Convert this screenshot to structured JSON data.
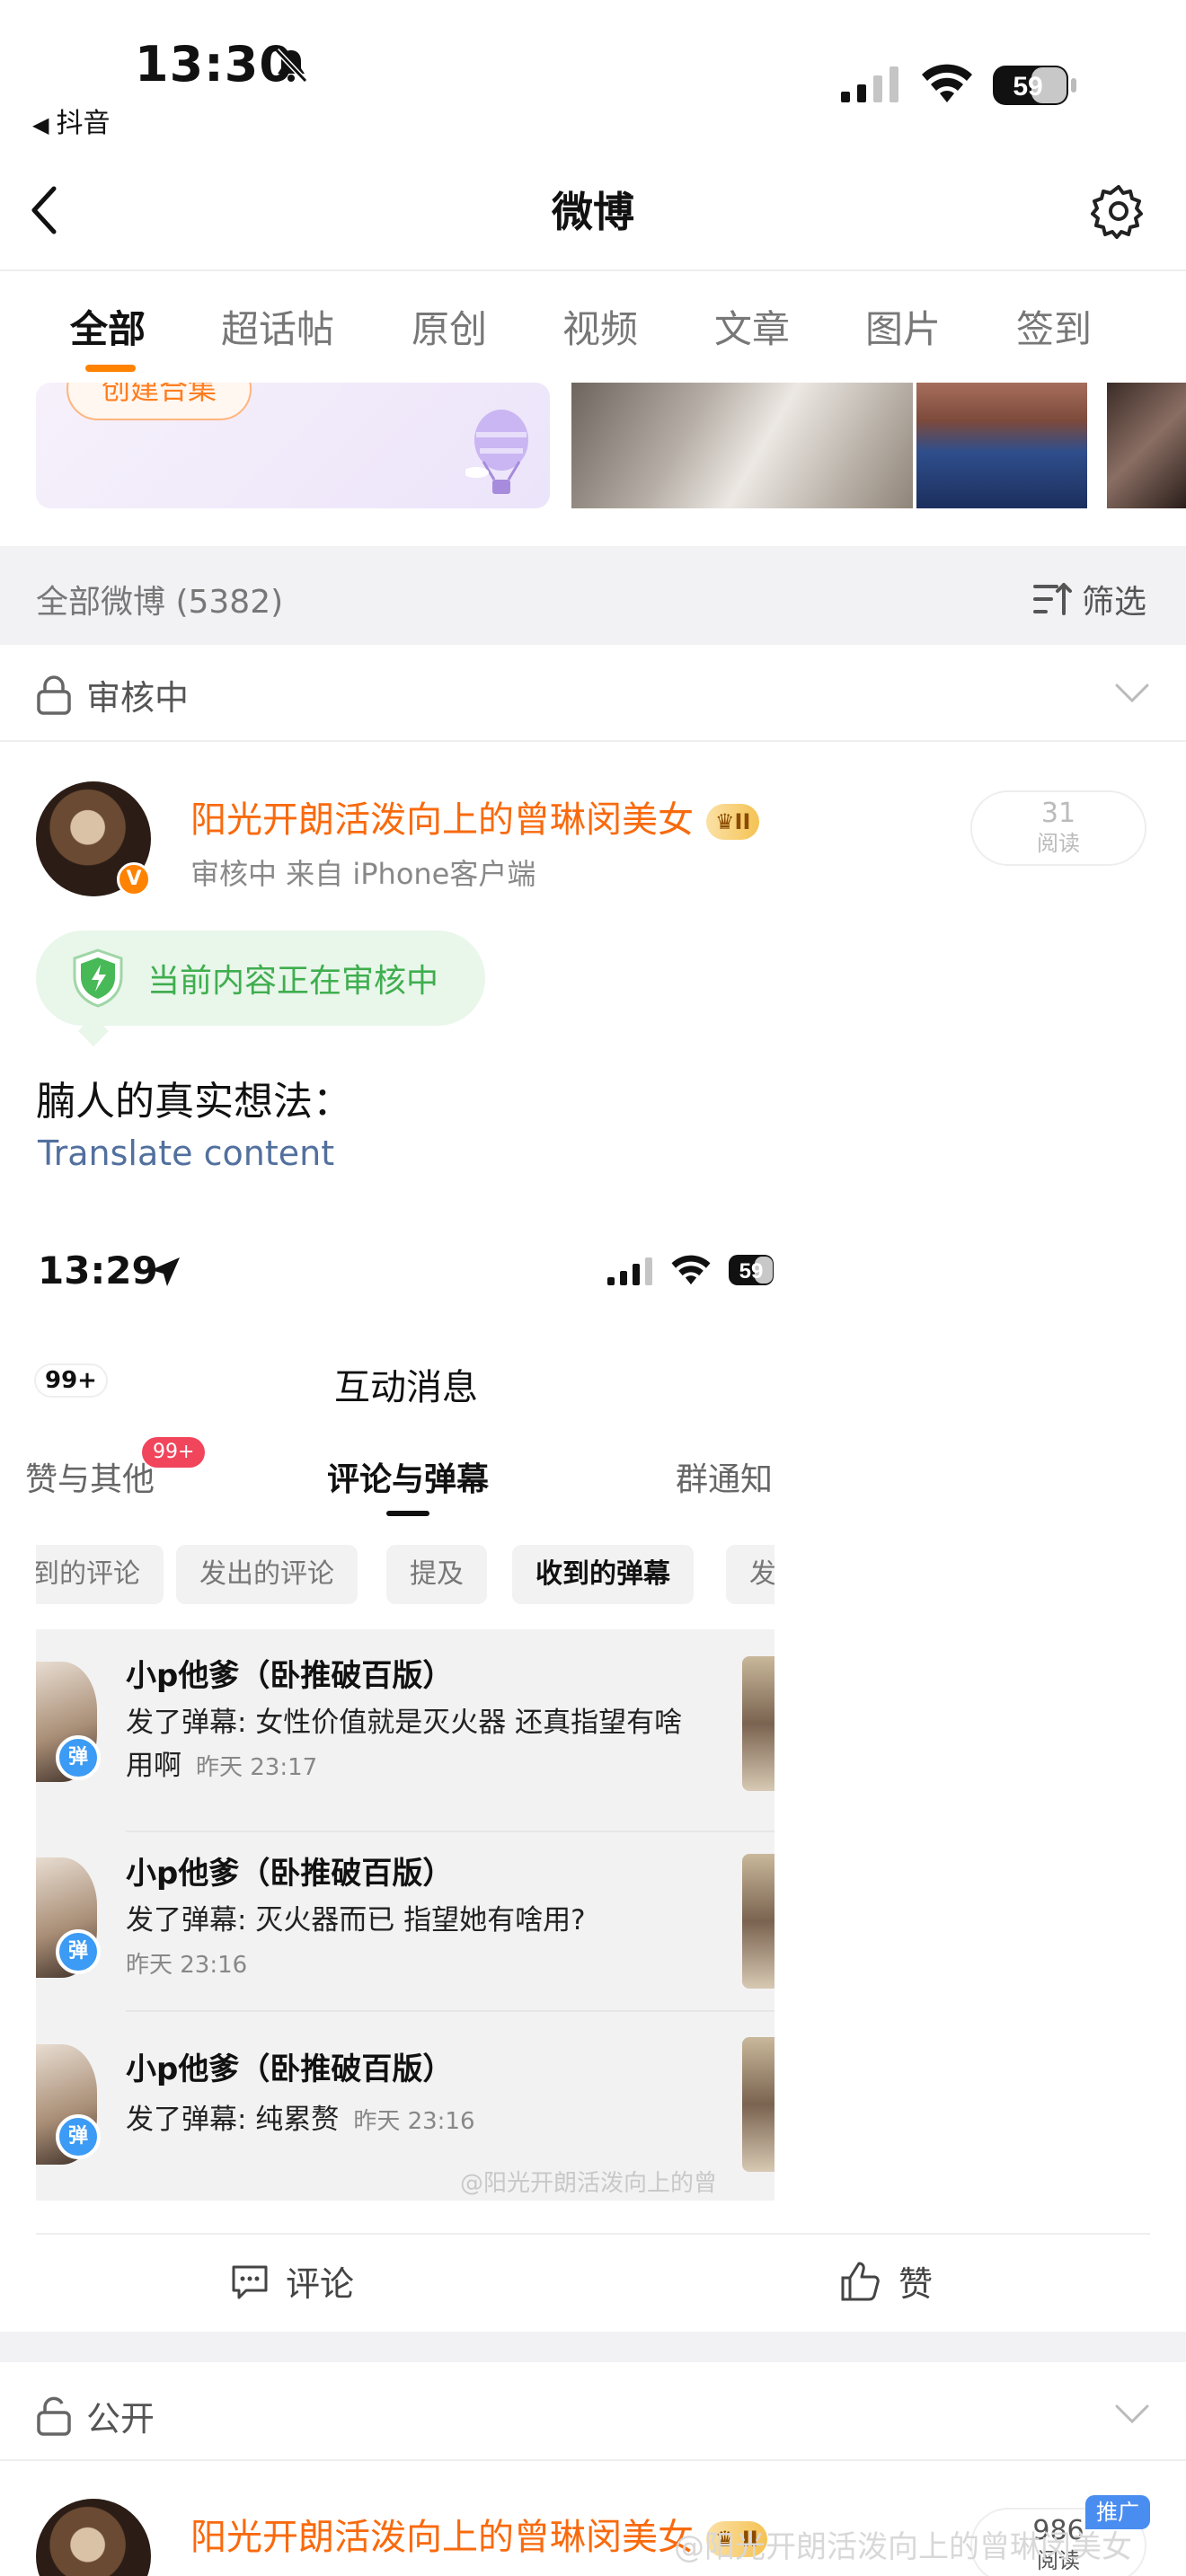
{
  "status_bar": {
    "time": "13:30",
    "back_app": "抖音",
    "battery": "59"
  },
  "nav": {
    "title": "微博"
  },
  "tabs": [
    {
      "label": "全部",
      "active": true
    },
    {
      "label": "超话帖"
    },
    {
      "label": "原创"
    },
    {
      "label": "视频"
    },
    {
      "label": "文章"
    },
    {
      "label": "图片"
    },
    {
      "label": "签到"
    }
  ],
  "gallery": {
    "create_collection_label": "创建合集"
  },
  "feed_header": {
    "all_weibo": "全部微博 (5382)",
    "filter_label": "筛选"
  },
  "section_review": {
    "label": "审核中"
  },
  "post1": {
    "author": "阳光开朗活泼向上的曾琳闵美女",
    "level_badge": "II",
    "meta": "审核中 来自 iPhone客户端",
    "read_count": "31",
    "read_label": "阅读",
    "review_notice": "当前内容正在审核中",
    "text": "腩人的真实想法：",
    "translate": "Translate content",
    "embedded": {
      "time": "13:29",
      "battery": "59",
      "badge_left": "99+",
      "title": "互动消息",
      "tabs": [
        "赞与其他",
        "评论与弹幕",
        "群通知"
      ],
      "tab_badge": "99+",
      "chips": [
        "到的评论",
        "发出的评论",
        "提及",
        "收到的弹幕",
        "发"
      ],
      "messages": [
        {
          "name": "小p他爹（卧推破百版）",
          "body": "发了弹幕: 女性价值就是灭火器 还真指望有啥用啊",
          "time": "昨天 23:17"
        },
        {
          "name": "小p他爹（卧推破百版）",
          "body": "发了弹幕: 灭火器而已 指望她有啥用?",
          "time": "昨天 23:16"
        },
        {
          "name": "小p他爹（卧推破百版）",
          "body": "发了弹幕: 纯累赘",
          "time": "昨天 23:16"
        }
      ],
      "dan_label": "弹",
      "watermark": "@阳光开朗活泼向上的曾"
    },
    "actions": {
      "comment": "评论",
      "like": "赞"
    }
  },
  "section_public": {
    "label": "公开"
  },
  "post2": {
    "author": "阳光开朗活泼向上的曾琳闵美女",
    "read_count": "986",
    "read_label": "阅读",
    "promo_label": "推广"
  },
  "watermark": "@阳光开朗活泼向上的曾琳闵美女",
  "colors": {
    "brand_orange": "#ff8200",
    "author_orange": "#f86a0e",
    "review_green": "#3fae4f",
    "link_blue": "#52709e"
  }
}
